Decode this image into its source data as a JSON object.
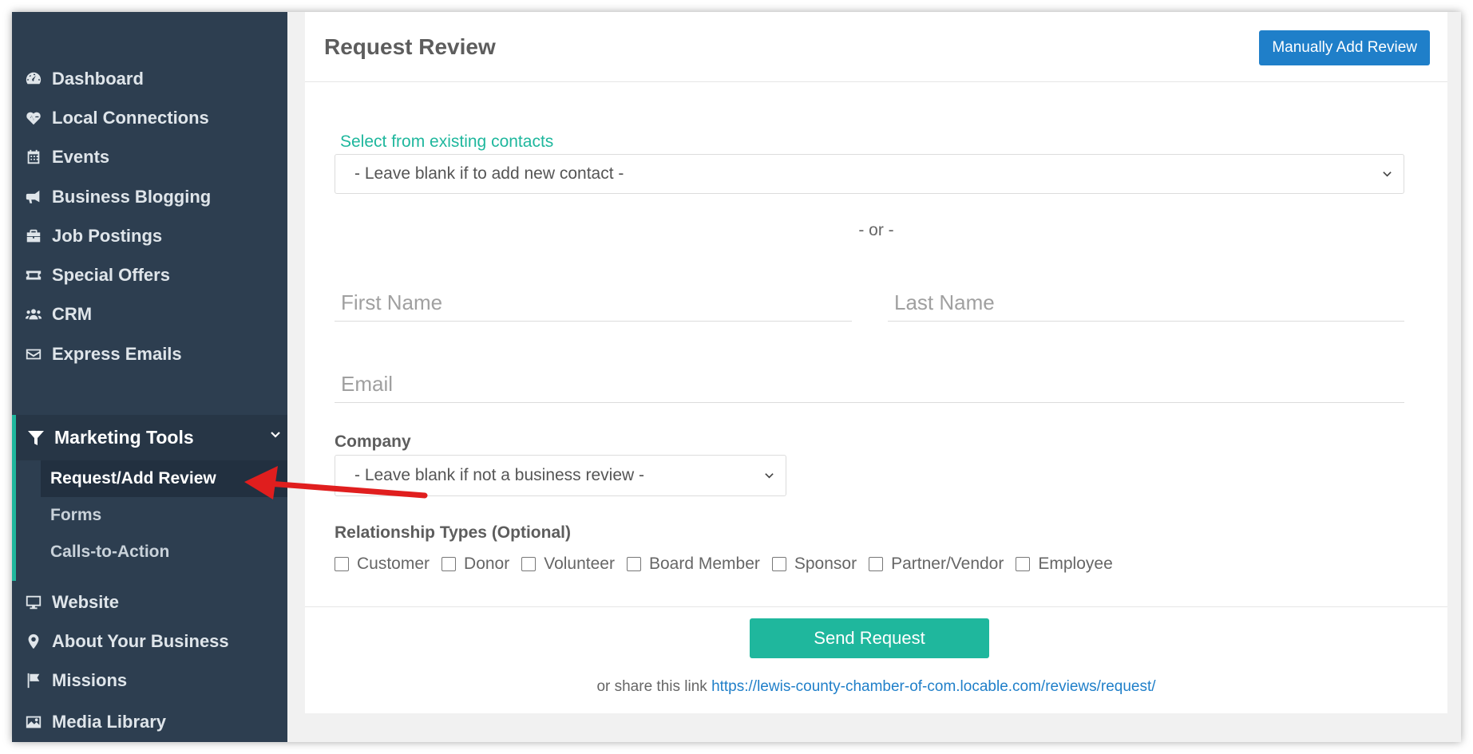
{
  "sidebar": {
    "items": [
      {
        "label": "Dashboard",
        "icon": "tachometer-icon"
      },
      {
        "label": "Local Connections",
        "icon": "heartbeat-icon"
      },
      {
        "label": "Events",
        "icon": "calendar-icon"
      },
      {
        "label": "Business Blogging",
        "icon": "megaphone-icon"
      },
      {
        "label": "Job Postings",
        "icon": "briefcase-icon"
      },
      {
        "label": "Special Offers",
        "icon": "ticket-icon"
      },
      {
        "label": "CRM",
        "icon": "users-icon"
      },
      {
        "label": "Express Emails",
        "icon": "envelope-icon"
      }
    ],
    "group": {
      "label": "Marketing Tools",
      "icon": "filter-icon",
      "sub_items": [
        "Request/Add Review",
        "Forms",
        "Calls-to-Action"
      ]
    },
    "items_after": [
      {
        "label": "Website",
        "icon": "monitor-icon"
      },
      {
        "label": "About Your Business",
        "icon": "map-marker-icon"
      },
      {
        "label": "Missions",
        "icon": "flag-icon"
      },
      {
        "label": "Media Library",
        "icon": "image-icon"
      }
    ]
  },
  "panel": {
    "title": "Request Review",
    "manual_button": "Manually Add Review",
    "contacts_label": "Select from existing contacts",
    "contacts_select": "- Leave blank if to add new contact -",
    "or_text": "- or -",
    "first_name_placeholder": "First Name",
    "last_name_placeholder": "Last Name",
    "email_placeholder": "Email",
    "company_label": "Company",
    "company_select": "- Leave blank if not a business review -",
    "relationship_label": "Relationship Types (Optional)",
    "relationships": [
      "Customer",
      "Donor",
      "Volunteer",
      "Board Member",
      "Sponsor",
      "Partner/Vendor",
      "Employee"
    ],
    "send_button": "Send Request",
    "share_prefix": "or share this link",
    "share_link": "https://lewis-county-chamber-of-com.locable.com/reviews/request/"
  },
  "colors": {
    "sidebar_bg": "#2d3e50",
    "accent_green": "#1fb79d",
    "accent_blue": "#1f7fc9",
    "annotation_arrow": "#e01e1e"
  }
}
